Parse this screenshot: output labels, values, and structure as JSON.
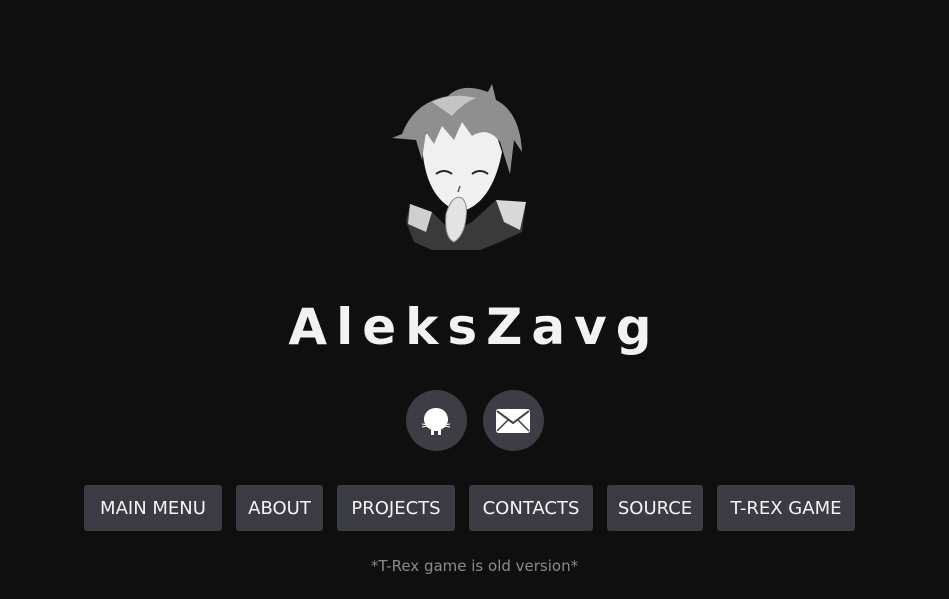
{
  "profile": {
    "name": "AleksZavg",
    "avatar": "anime-boy-avatar"
  },
  "social": [
    {
      "icon": "github-icon"
    },
    {
      "icon": "mail-icon"
    }
  ],
  "nav": {
    "items": [
      {
        "label": "MAIN MENU"
      },
      {
        "label": "ABOUT"
      },
      {
        "label": "PROJECTS"
      },
      {
        "label": "CONTACTS"
      },
      {
        "label": "SOURCE"
      },
      {
        "label": "T-REX GAME"
      }
    ]
  },
  "note": "*T-Rex game is old version*",
  "colors": {
    "background": "#0f0f10",
    "button": "#3b3b43",
    "text": "#f2f2f2",
    "muted": "#8a8a8a"
  }
}
